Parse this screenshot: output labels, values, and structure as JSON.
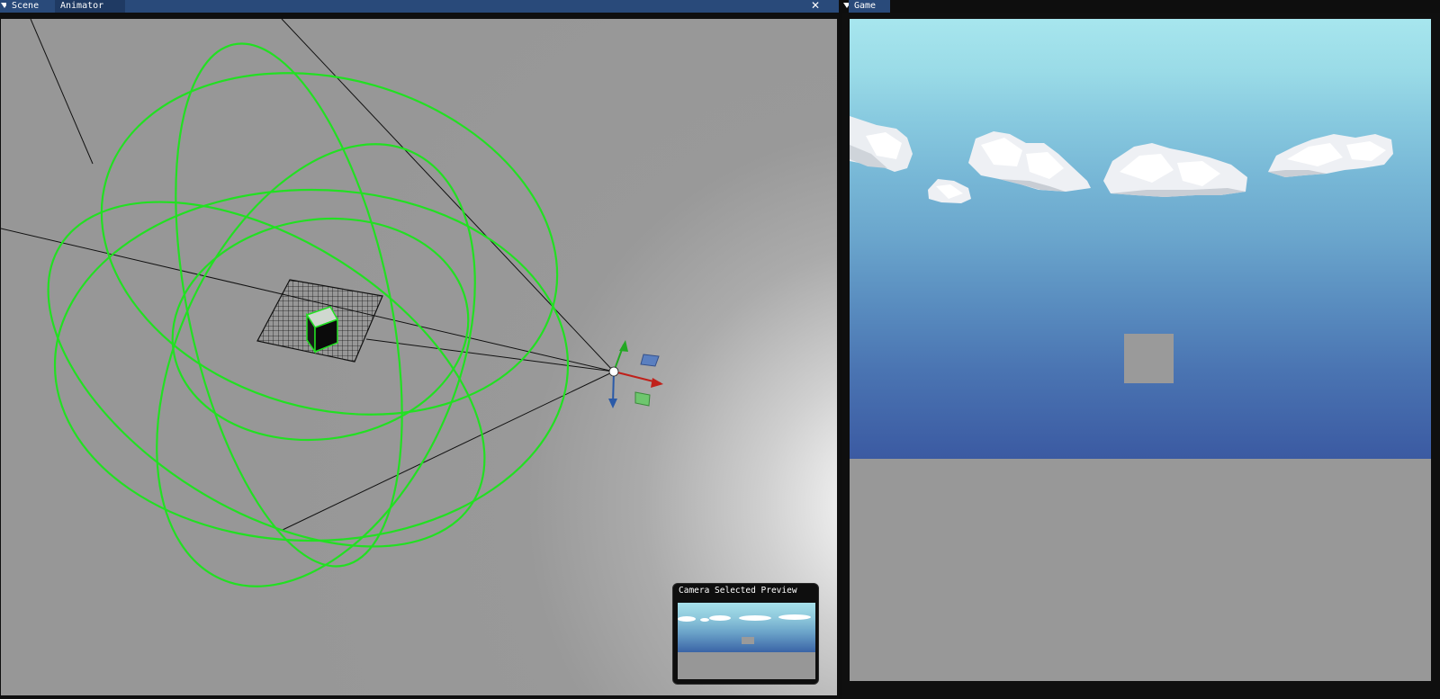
{
  "scene_panel": {
    "tabs": [
      {
        "label": "Scene",
        "active": true
      },
      {
        "label": "Animator",
        "active": false
      }
    ],
    "close_symbol": "✕",
    "camera_preview": {
      "title": "Camera Selected Preview"
    }
  },
  "game_panel": {
    "tabs": [
      {
        "label": "Game",
        "active": true
      }
    ],
    "close_symbol": "✕"
  },
  "colors": {
    "title_bar": "#294a7a",
    "viewport_gray": "#979797",
    "gizmo_green": "#22e022",
    "axis_x": "#c0201a",
    "axis_y": "#22a822",
    "axis_z": "#2a5aa8",
    "sky_top": "#a7e6ee",
    "sky_bottom": "#3b5aa2"
  },
  "icons": [
    "collapse-arrow-icon",
    "close-icon",
    "transform-gizmo-icon",
    "cube-icon",
    "cloud-icon"
  ]
}
